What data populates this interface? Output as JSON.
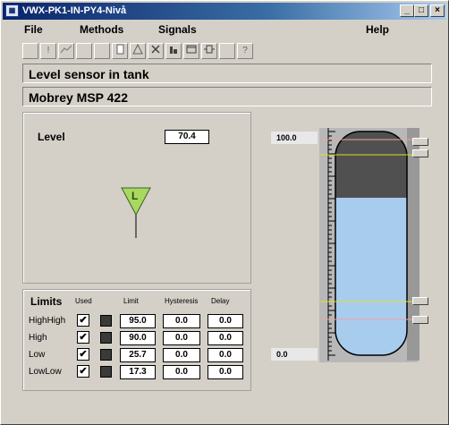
{
  "window": {
    "title": "VWX-PK1-IN-PY4-Nivå",
    "icon": "grid-app-icon",
    "controls": [
      "minimize-icon",
      "maximize-icon",
      "close-icon"
    ]
  },
  "menu": {
    "file": "File",
    "methods": "Methods",
    "signals": "Signals",
    "help": "Help"
  },
  "toolbar": {
    "buttons": [
      {
        "icon": "blank-icon"
      },
      {
        "icon": "exclaim-icon"
      },
      {
        "icon": "trend-icon"
      },
      {
        "icon": "blank-icon"
      },
      {
        "icon": "blank-icon"
      },
      {
        "icon": "page-icon"
      },
      {
        "icon": "warning-icon"
      },
      {
        "icon": "close-x-icon"
      },
      {
        "icon": "bars-icon"
      },
      {
        "icon": "window-icon"
      },
      {
        "icon": "component-icon"
      },
      {
        "icon": "blank-icon"
      },
      {
        "icon": "help-icon"
      }
    ],
    "help_glyph": "?"
  },
  "object": {
    "description": "Level sensor in tank",
    "device": "Mobrey MSP 422"
  },
  "measurement": {
    "label": "Level",
    "value": "70.4",
    "symbol_letter": "L"
  },
  "limits": {
    "title": "Limits",
    "headers": {
      "used": "Used",
      "limit": "Limit",
      "hysteresis": "Hysteresis",
      "delay": "Delay"
    },
    "rows": [
      {
        "name": "HighHigh",
        "used": true,
        "limit": "95.0",
        "hysteresis": "0.0",
        "delay": "0.0"
      },
      {
        "name": "High",
        "used": true,
        "limit": "90.0",
        "hysteresis": "0.0",
        "delay": "0.0"
      },
      {
        "name": "Low",
        "used": true,
        "limit": "25.7",
        "hysteresis": "0.0",
        "delay": "0.0"
      },
      {
        "name": "LowLow",
        "used": true,
        "limit": "17.3",
        "hysteresis": "0.0",
        "delay": "0.0"
      }
    ]
  },
  "tank": {
    "scale_max": "100.0",
    "scale_min": "0.0",
    "level_fraction": 0.704,
    "colors": {
      "liquid": "#a8ccee",
      "empty": "#505050",
      "limit_line": "#e0e020",
      "alarm_line": "#f0a0a0"
    }
  }
}
